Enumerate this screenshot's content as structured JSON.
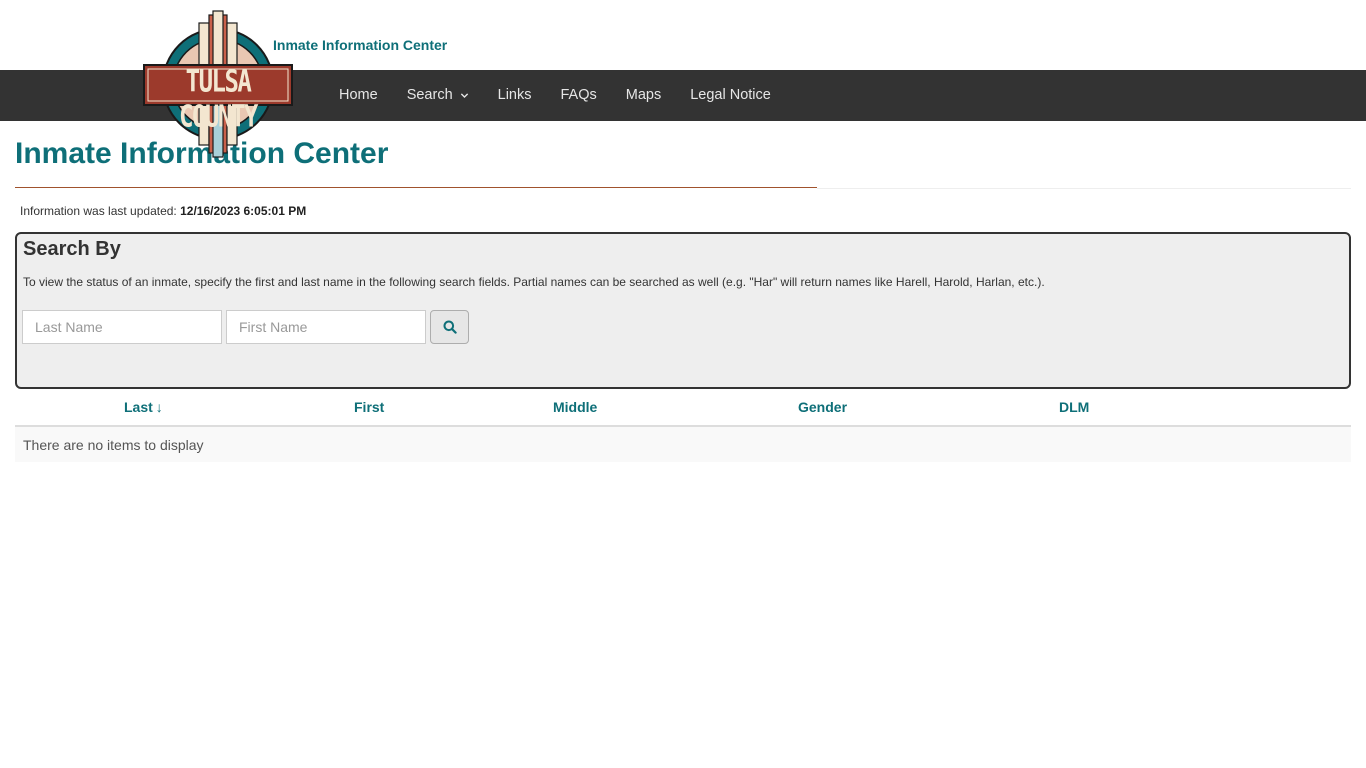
{
  "header": {
    "site_name": "Inmate Information Center",
    "logo_text": "TULSA COUNTY"
  },
  "nav": {
    "items": [
      {
        "label": "Home"
      },
      {
        "label": "Search",
        "has_dropdown": true
      },
      {
        "label": "Links"
      },
      {
        "label": "FAQs"
      },
      {
        "label": "Maps"
      },
      {
        "label": "Legal Notice"
      }
    ]
  },
  "page": {
    "title": "Inmate Information Center",
    "updated_label": "Information was last updated:",
    "updated_value": "12/16/2023 6:05:01 PM"
  },
  "search": {
    "heading": "Search By",
    "help_text": "To view the status of an inmate, specify the first and last name in the following search fields. Partial names can be searched as well (e.g. \"Har\" will return names like Harell, Harold, Harlan, etc.).",
    "last_name_placeholder": "Last Name",
    "first_name_placeholder": "First Name",
    "button_icon": "search-icon"
  },
  "results": {
    "columns": [
      {
        "label": "Last",
        "sort": "↓"
      },
      {
        "label": "First"
      },
      {
        "label": "Middle"
      },
      {
        "label": "Gender"
      },
      {
        "label": "DLM"
      }
    ],
    "empty_message": "There are no items to display"
  },
  "colors": {
    "accent_teal": "#0e6f78",
    "nav_bg": "#333333",
    "logo_red": "#9c3a2c",
    "panel_bg": "#eeeeee"
  }
}
